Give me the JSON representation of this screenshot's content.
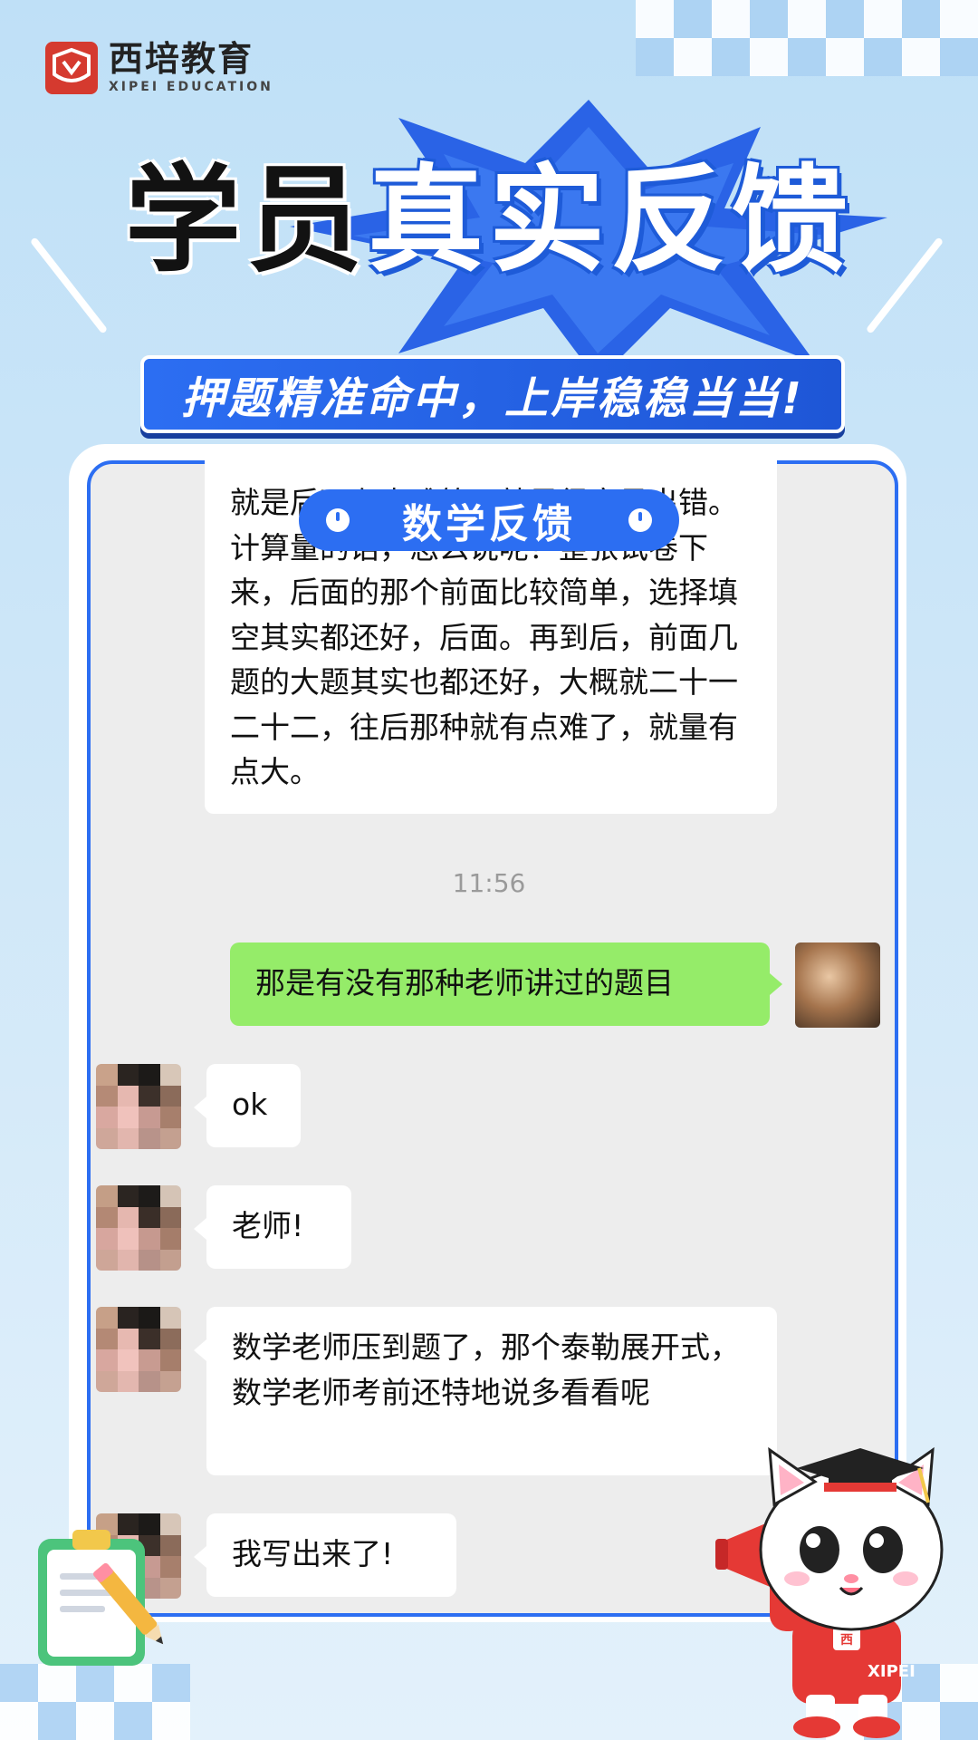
{
  "brand": {
    "name_cn": "西培教育",
    "name_en": "XIPEI EDUCATION",
    "logo_char": "西"
  },
  "headline": {
    "part1": "学员",
    "part2": "真实反馈"
  },
  "banner_text": "押题精准命中，上岸稳稳当当!",
  "section_label": "数学反馈",
  "colors": {
    "accent_blue": "#2c6ef2",
    "brand_red": "#d53a2f",
    "bubble_green": "#95ec69",
    "chat_bg": "#ededed"
  },
  "chat": {
    "first_message": "就是后面有点难第一就是很容易出错。计算量的话，怎么说呢？整张试卷下来，后面的那个前面比较简单，选择填空其实都还好，后面。再到后，前面几题的大题其实也都还好，大概就二十一二十二，往后那种就有点难了，就量有点大。",
    "timestamp": "11:56",
    "sent_message": "那是有没有那种老师讲过的题目",
    "replies": [
      "ok",
      "老师!",
      "数学老师压到题了，那个泰勒展开式，数学老师考前还特地说多看看呢",
      "我写出来了!"
    ]
  },
  "mascot": {
    "shirt_label": "XIPEI",
    "badge_char": "西"
  }
}
